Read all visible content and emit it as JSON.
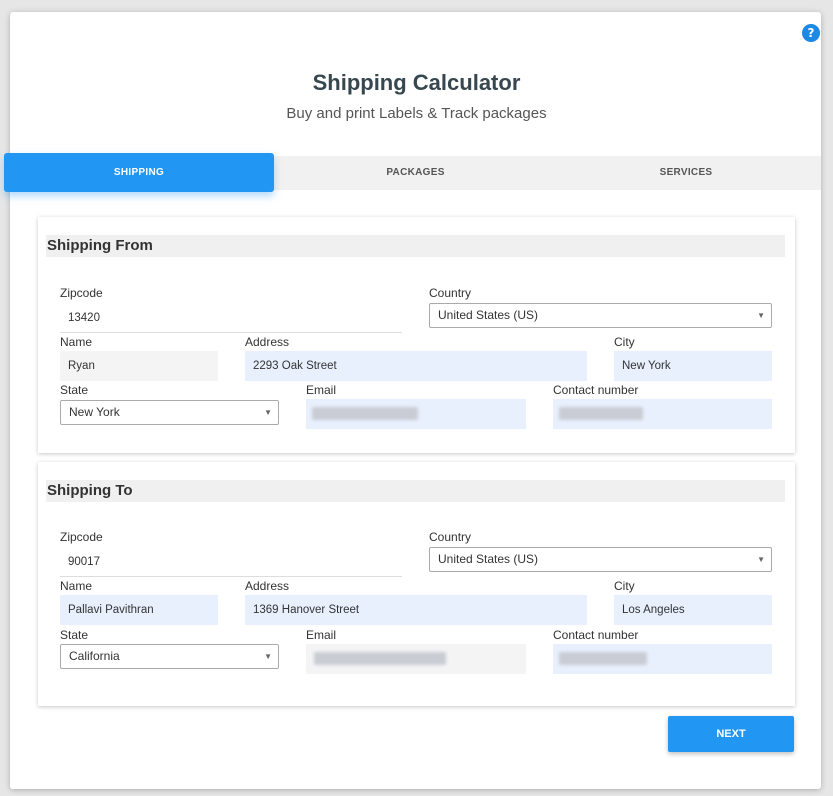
{
  "header": {
    "title": "Shipping Calculator",
    "subtitle": "Buy and print Labels & Track packages",
    "help_glyph": "?"
  },
  "tabs": [
    {
      "label": "SHIPPING",
      "active": true
    },
    {
      "label": "PACKAGES",
      "active": false
    },
    {
      "label": "SERVICES",
      "active": false
    }
  ],
  "shipping_from": {
    "heading": "Shipping From",
    "labels": {
      "zipcode": "Zipcode",
      "country": "Country",
      "name": "Name",
      "address": "Address",
      "city": "City",
      "state": "State",
      "email": "Email",
      "contact": "Contact number"
    },
    "values": {
      "zipcode": "13420",
      "country": "United States (US)",
      "name": "Ryan",
      "address": "2293  Oak Street",
      "city": "New York",
      "state": "New York"
    }
  },
  "shipping_to": {
    "heading": "Shipping To",
    "labels": {
      "zipcode": "Zipcode",
      "country": "Country",
      "name": "Name",
      "address": "Address",
      "city": "City",
      "state": "State",
      "email": "Email",
      "contact": "Contact number"
    },
    "values": {
      "zipcode": "90017",
      "country": "United States (US)",
      "name": "Pallavi Pavithran",
      "address": "1369  Hanover Street",
      "city": "Los Angeles",
      "state": "California"
    }
  },
  "actions": {
    "next_label": "NEXT"
  },
  "icons": {
    "help": "help-circle-icon",
    "dropdown": "chevron-down-icon"
  },
  "colors": {
    "accent": "#2196f3",
    "field_fill": "#e8f0fe",
    "title": "#37474f"
  }
}
